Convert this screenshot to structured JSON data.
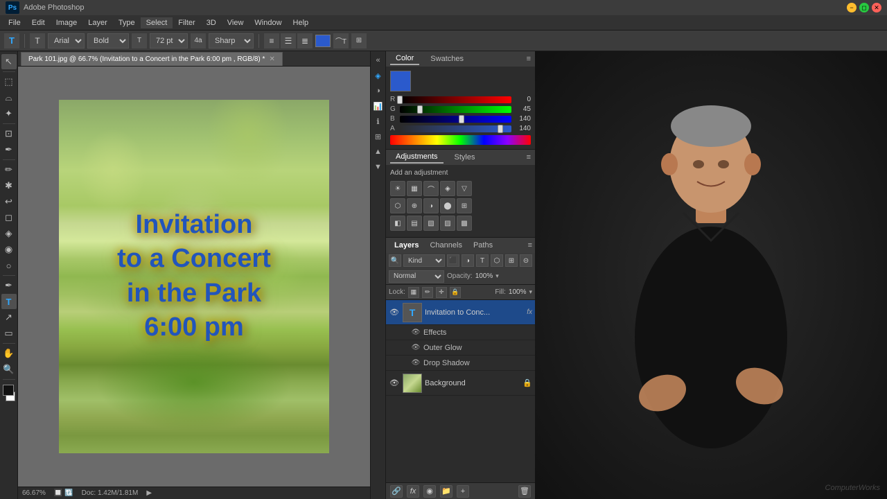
{
  "titlebar": {
    "ps_label": "Ps",
    "title": "Adobe Photoshop",
    "minimize": "−",
    "maximize": "◻",
    "close": "✕"
  },
  "menubar": {
    "items": [
      "File",
      "Edit",
      "Image",
      "Layer",
      "Type",
      "Select",
      "Filter",
      "3D",
      "View",
      "Window",
      "Help"
    ]
  },
  "optionsbar": {
    "font_family": "Arial",
    "font_style": "Bold",
    "font_size": "72 pt",
    "anti_alias": "Sharp"
  },
  "tab": {
    "label": "Park 101.jpg @ 66.7% (Invitation to a Concert in the Park 6:00 pm , RGB/8) *",
    "close": "✕"
  },
  "canvas": {
    "text_line1": "Invitation",
    "text_line2": "to a Concert",
    "text_line3": "in the Park",
    "text_line4": "6:00 pm"
  },
  "statusbar": {
    "zoom": "66.67%",
    "doc_size": "Doc: 1.42M/1.81M",
    "arrow": "▶"
  },
  "color_panel": {
    "tab_color": "Color",
    "tab_swatches": "Swatches",
    "r_label": "R",
    "r_value": "0",
    "r_percent": 0,
    "g_label": "G",
    "g_value": "45",
    "g_percent": 18,
    "b_label": "B",
    "b_value": "140",
    "b_percent": 55
  },
  "adjustments_panel": {
    "tab_adjustments": "Adjustments",
    "tab_styles": "Styles",
    "title": "Add an adjustment"
  },
  "layers_panel": {
    "tab_layers": "Layers",
    "tab_channels": "Channels",
    "tab_paths": "Paths",
    "filter_label": "Kind",
    "blend_mode": "Normal",
    "opacity_label": "Opacity:",
    "opacity_value": "100%",
    "lock_label": "Lock:",
    "fill_label": "Fill:",
    "fill_value": "100%",
    "layers": [
      {
        "name": "Invitation to Conc...",
        "type": "text",
        "thumb": "T",
        "fx": "fx",
        "selected": true,
        "effects": [
          {
            "name": "Effects",
            "eye": true
          },
          {
            "name": "Outer Glow",
            "eye": true
          },
          {
            "name": "Drop Shadow",
            "eye": true
          }
        ]
      },
      {
        "name": "Background",
        "type": "image",
        "thumb": "",
        "locked": true,
        "selected": false
      }
    ]
  },
  "footer_buttons": [
    "🔗",
    "fx",
    "◉",
    "📁",
    "🗑"
  ]
}
